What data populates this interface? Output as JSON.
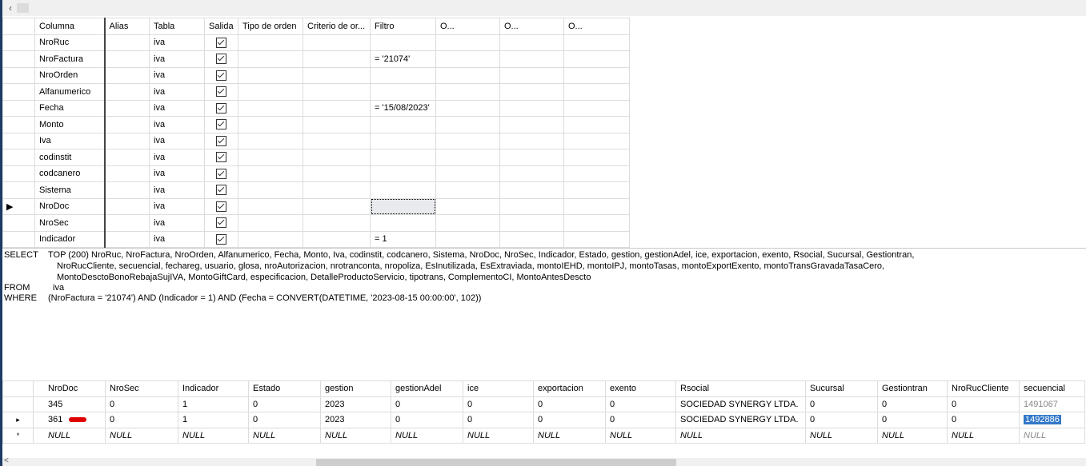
{
  "scroll_left_arrow": "‹",
  "criteria": {
    "headers": [
      "Columna",
      "Alias",
      "Tabla",
      "Salida",
      "Tipo de orden",
      "Criterio de or...",
      "Filtro",
      "O...",
      "O...",
      "O..."
    ],
    "rows": [
      {
        "columna": "NroRuc",
        "tabla": "iva",
        "salida": true,
        "filtro": ""
      },
      {
        "columna": "NroFactura",
        "tabla": "iva",
        "salida": true,
        "filtro": "= '21074'"
      },
      {
        "columna": "NroOrden",
        "tabla": "iva",
        "salida": true,
        "filtro": ""
      },
      {
        "columna": "Alfanumerico",
        "tabla": "iva",
        "salida": true,
        "filtro": ""
      },
      {
        "columna": "Fecha",
        "tabla": "iva",
        "salida": true,
        "filtro": "= '15/08/2023'"
      },
      {
        "columna": "Monto",
        "tabla": "iva",
        "salida": true,
        "filtro": ""
      },
      {
        "columna": "Iva",
        "tabla": "iva",
        "salida": true,
        "filtro": ""
      },
      {
        "columna": "codinstit",
        "tabla": "iva",
        "salida": true,
        "filtro": ""
      },
      {
        "columna": "codcanero",
        "tabla": "iva",
        "salida": true,
        "filtro": ""
      },
      {
        "columna": "Sistema",
        "tabla": "iva",
        "salida": true,
        "filtro": ""
      },
      {
        "columna": "NroDoc",
        "tabla": "iva",
        "salida": true,
        "filtro": "",
        "current": true
      },
      {
        "columna": "NroSec",
        "tabla": "iva",
        "salida": true,
        "filtro": ""
      },
      {
        "columna": "Indicador",
        "tabla": "iva",
        "salida": true,
        "filtro": "= 1"
      }
    ]
  },
  "sql": {
    "select_kw": "SELECT",
    "select_line1": "TOP (200) NroRuc, NroFactura, NroOrden, Alfanumerico, Fecha, Monto, Iva, codinstit, codcanero, Sistema, NroDoc, NroSec, Indicador, Estado, gestion, gestionAdel, ice, exportacion, exento, Rsocial, Sucursal, Gestiontran,",
    "select_line2": "NroRucCliente, secuencial, fechareg, usuario, glosa, nroAutorizacion, nrotranconta, nropoliza, EsInutilizada, EsExtraviada, montoIEHD, montoIPJ, montoTasas, montoExportExento, montoTransGravadaTasaCero,",
    "select_line3": "MontoDesctoBonoRebajaSujIVA, MontoGiftCard, especificacion, DetalleProductoServicio, tipotrans, ComplementoCI, MontoAntesDescto",
    "from_kw": "FROM",
    "from_val": "iva",
    "where_kw": "WHERE",
    "where_val": "(NroFactura = '21074') AND (Indicador = 1) AND (Fecha = CONVERT(DATETIME, '2023-08-15 00:00:00', 102))"
  },
  "results": {
    "headers": [
      "NroDoc",
      "NroSec",
      "Indicador",
      "Estado",
      "gestion",
      "gestionAdel",
      "ice",
      "exportacion",
      "exento",
      "Rsocial",
      "Sucursal",
      "Gestiontran",
      "NroRucCliente",
      "secuencial"
    ],
    "rows": [
      {
        "marker": "",
        "cells": [
          "345",
          "0",
          "1",
          "0",
          "2023",
          "0",
          "0",
          "0",
          "0",
          "SOCIEDAD SYNERGY LTDA.",
          "0",
          "0",
          "0",
          "1491067"
        ]
      },
      {
        "marker": "▸",
        "cells": [
          "361",
          "0",
          "1",
          "0",
          "2023",
          "0",
          "0",
          "0",
          "0",
          "SOCIEDAD SYNERGY LTDA.",
          "0",
          "0",
          "0",
          "1492886"
        ]
      },
      {
        "marker": "*",
        "cells": [
          "NULL",
          "NULL",
          "NULL",
          "NULL",
          "NULL",
          "NULL",
          "NULL",
          "NULL",
          "NULL",
          "NULL",
          "NULL",
          "NULL",
          "NULL",
          "NULL"
        ]
      }
    ]
  }
}
